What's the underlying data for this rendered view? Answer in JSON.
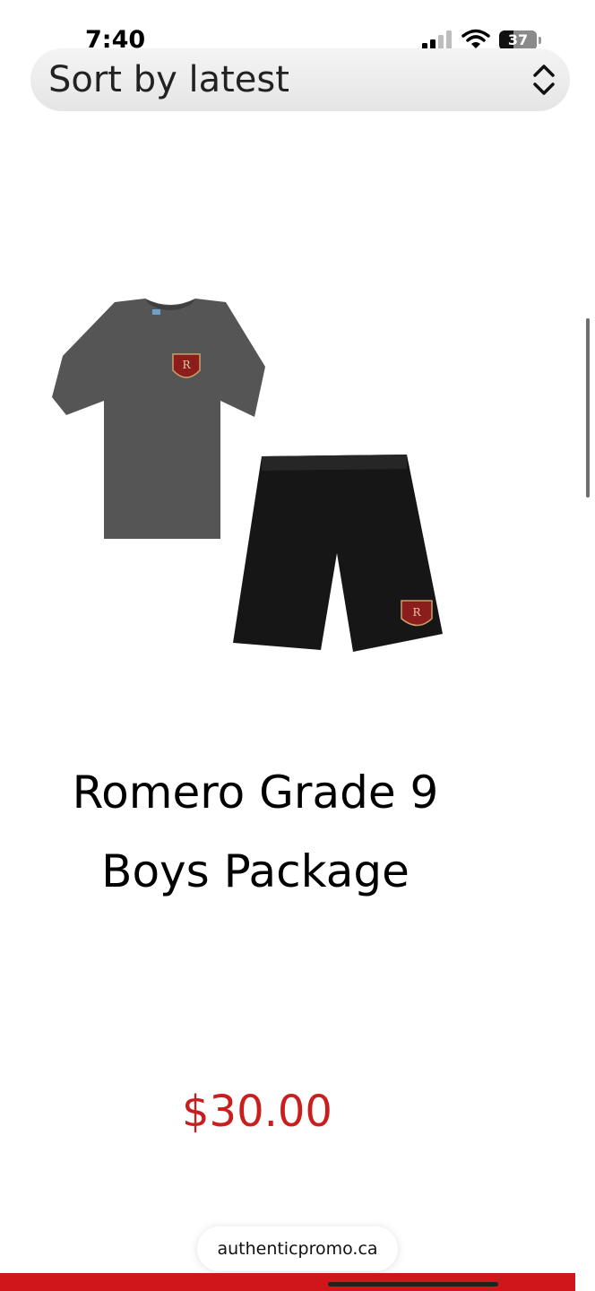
{
  "status_bar": {
    "time": "7:40",
    "battery_level": "37",
    "battery_fraction": 0.37
  },
  "sort_select": {
    "label": "Sort by latest"
  },
  "product": {
    "title_line1": "Romero Grade 9",
    "title_line2": "Boys Package",
    "price": "$30.00",
    "image_icon": "tshirt-and-shorts-image"
  },
  "browser": {
    "url": "authenticpromo.ca"
  },
  "colors": {
    "price": "#c81e1e",
    "footer_bar": "#d0161a",
    "crest": "#8b1d1d"
  }
}
